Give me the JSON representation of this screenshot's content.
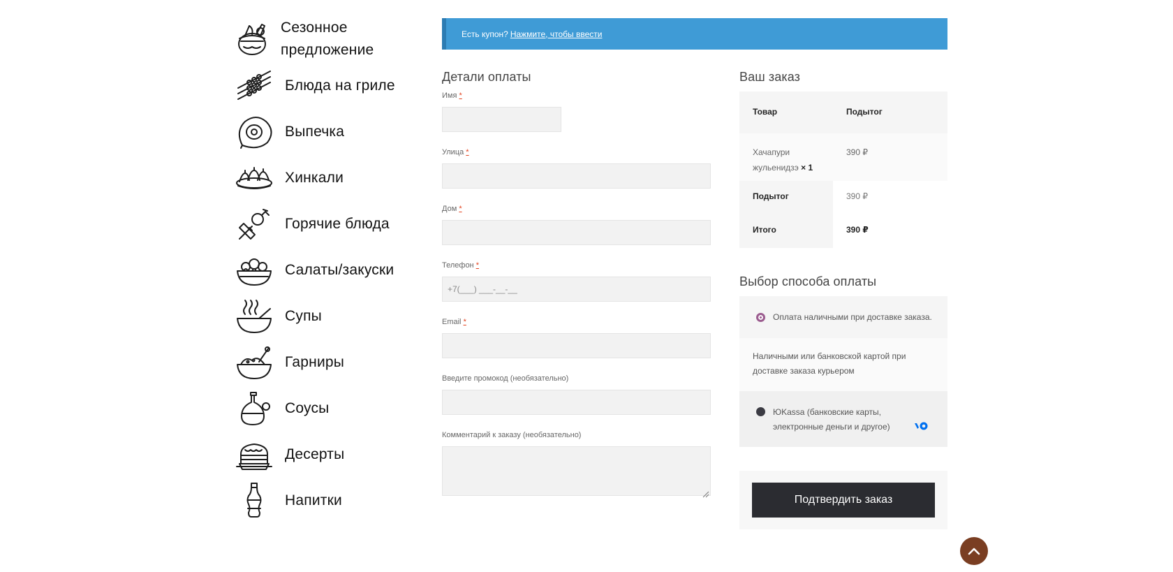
{
  "categories": [
    {
      "label": "Сезонное предложение",
      "icon": "seasonal-basket-icon"
    },
    {
      "label": "Блюда на гриле",
      "icon": "skewers-icon"
    },
    {
      "label": "Выпечка",
      "icon": "khachapuri-icon"
    },
    {
      "label": "Хинкали",
      "icon": "khinkali-icon"
    },
    {
      "label": "Горячие блюда",
      "icon": "hot-dish-icon"
    },
    {
      "label": "Салаты/закуски",
      "icon": "salad-bowl-icon"
    },
    {
      "label": "Супы",
      "icon": "soup-bowl-icon"
    },
    {
      "label": "Гарниры",
      "icon": "garnish-bowl-icon"
    },
    {
      "label": "Соусы",
      "icon": "sauce-bottle-icon"
    },
    {
      "label": "Десерты",
      "icon": "cake-icon"
    },
    {
      "label": "Напитки",
      "icon": "soda-bottle-icon"
    }
  ],
  "coupon": {
    "text": "Есть купон?",
    "link": "Нажмите, чтобы ввести"
  },
  "billing": {
    "title": "Детали оплаты",
    "required_mark": "*",
    "fields": {
      "name": {
        "label": "Имя"
      },
      "street": {
        "label": "Улица"
      },
      "house": {
        "label": "Дом"
      },
      "phone": {
        "label": "Телефон",
        "placeholder": "+7(___) ___-__-__"
      },
      "email": {
        "label": "Email"
      },
      "promo": {
        "label": "Введите промокод (необязательно)"
      },
      "comment": {
        "label": "Комментарий к заказу (необязательно)"
      }
    }
  },
  "order": {
    "title": "Ваш заказ",
    "col_product": "Товар",
    "col_subtotal": "Подытог",
    "item_name": "Хачапури жульенидзэ",
    "item_qty": "× 1",
    "item_price": "390 ₽",
    "subtotal_label": "Подытог",
    "subtotal_value": "390 ₽",
    "total_label": "Итого",
    "total_value": "390 ₽"
  },
  "payment": {
    "title": "Выбор способа оплаты",
    "cash_label": "Оплата наличными при доставке заказа.",
    "cash_desc": "Наличными или банковской картой при доставке заказа курьером",
    "yookassa_label": "ЮKassa (банковские карты, электронные деньги и другое)",
    "accent_color": "#9b5c8f",
    "yookassa_color": "#0070f0"
  },
  "confirm_label": "Подтвердить заказ",
  "colors": {
    "coupon_bg": "#3f9bd6",
    "button_bg": "#2b2c31",
    "to_top_bg": "#7a3e22"
  }
}
